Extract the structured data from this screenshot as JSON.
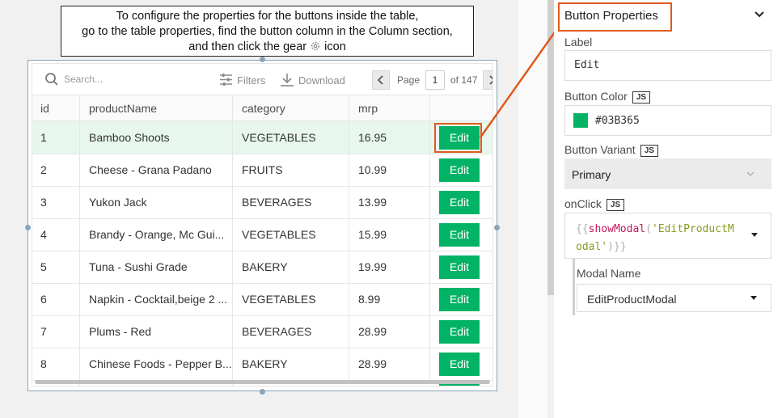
{
  "callout": {
    "line1": "To configure the properties for the buttons inside the table,",
    "line2": "go to the table properties, find the button column in the Column section,",
    "line3_before": "and then click the gear",
    "line3_after": "icon"
  },
  "toolbar": {
    "search_placeholder": "Search...",
    "filters_label": "Filters",
    "download_label": "Download",
    "page_label": "Page",
    "page_value": "1",
    "page_total": "of 147"
  },
  "table": {
    "columns": [
      "id",
      "productName",
      "category",
      "mrp",
      ""
    ],
    "rows": [
      {
        "id": "1",
        "productName": "Bamboo Shoots",
        "category": "VEGETABLES",
        "mrp": "16.95",
        "action": "Edit"
      },
      {
        "id": "2",
        "productName": "Cheese - Grana Padano",
        "category": "FRUITS",
        "mrp": "10.99",
        "action": "Edit"
      },
      {
        "id": "3",
        "productName": "Yukon Jack",
        "category": "BEVERAGES",
        "mrp": "13.99",
        "action": "Edit"
      },
      {
        "id": "4",
        "productName": "Brandy - Orange, Mc Gui...",
        "category": "VEGETABLES",
        "mrp": "15.99",
        "action": "Edit"
      },
      {
        "id": "5",
        "productName": "Tuna - Sushi Grade",
        "category": "BAKERY",
        "mrp": "19.99",
        "action": "Edit"
      },
      {
        "id": "6",
        "productName": "Napkin - Cocktail,beige 2 ...",
        "category": "VEGETABLES",
        "mrp": "8.99",
        "action": "Edit"
      },
      {
        "id": "7",
        "productName": "Plums - Red",
        "category": "BEVERAGES",
        "mrp": "28.99",
        "action": "Edit"
      },
      {
        "id": "8",
        "productName": "Chinese Foods - Pepper B...",
        "category": "BAKERY",
        "mrp": "28.99",
        "action": "Edit"
      }
    ]
  },
  "panel": {
    "section_title": "Button Properties",
    "label_label": "Label",
    "label_value": "Edit",
    "color_label": "Button Color",
    "color_value": "#03B365",
    "js_badge": "JS",
    "variant_label": "Button Variant",
    "variant_value": "Primary",
    "onclick_label": "onClick",
    "onclick_code_line1": "{{showModal('EditProductM",
    "onclick_code_line2": "odal')}}",
    "onclick_code_parts": {
      "open": "{{",
      "fn": "showModal",
      "paren_open": "(",
      "str1": "'EditProductM",
      "str2": "odal'",
      "close": ")}}"
    },
    "modal_name_label": "Modal Name",
    "modal_name_value": "EditProductModal"
  },
  "colors": {
    "accent_green": "#03B365",
    "highlight_orange": "#e05a1c",
    "selected_row": "#e8f7ee"
  },
  "icons": [
    "search-icon",
    "filter-icon",
    "download-icon",
    "chevron-left-icon",
    "chevron-right-icon",
    "gear-icon",
    "chevron-down-icon",
    "caret-down-icon"
  ]
}
